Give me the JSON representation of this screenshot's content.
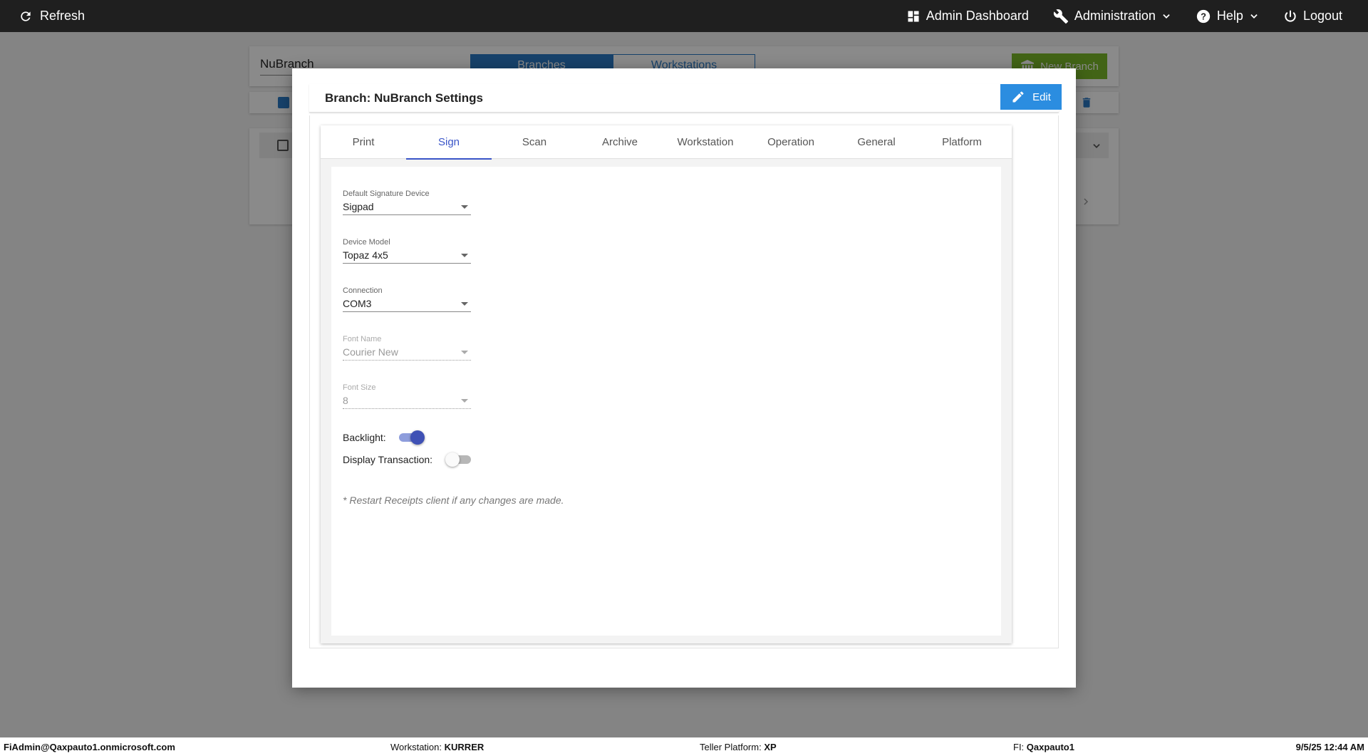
{
  "topbar": {
    "refresh_label": "Refresh",
    "nav": {
      "admin_dashboard": "Admin Dashboard",
      "administration": "Administration",
      "help": "Help",
      "logout": "Logout"
    }
  },
  "background": {
    "branch_select_value": "NuBranch",
    "tabs": [
      "Branches",
      "Workstations"
    ],
    "new_branch_label": "New Branch"
  },
  "modal": {
    "title": "Branch: NuBranch Settings",
    "edit_label": "Edit",
    "tabs": [
      "Print",
      "Sign",
      "Scan",
      "Archive",
      "Workstation",
      "Operation",
      "General",
      "Platform"
    ],
    "active_tab": "Sign",
    "fields": {
      "default_signature_device": {
        "label": "Default Signature Device",
        "value": "Sigpad"
      },
      "device_model": {
        "label": "Device Model",
        "value": "Topaz 4x5"
      },
      "connection": {
        "label": "Connection",
        "value": "COM3"
      },
      "font_name": {
        "label": "Font Name",
        "value": "Courier New"
      },
      "font_size": {
        "label": "Font Size",
        "value": "8"
      }
    },
    "toggles": {
      "backlight": {
        "label": "Backlight:",
        "on": true
      },
      "display_transaction": {
        "label": "Display Transaction:",
        "on": false
      }
    },
    "note": "* Restart Receipts client if any changes are made."
  },
  "statusbar": {
    "user": "FiAdmin@Qaxpauto1.onmicrosoft.com",
    "workstation_label": "Workstation:",
    "workstation_value": "KURRER",
    "platform_label": "Teller Platform:",
    "platform_value": "XP",
    "fi_label": "FI:",
    "fi_value": "Qaxpauto1",
    "datetime": "9/5/25 12:44 AM"
  },
  "colors": {
    "topbar": "#1f1f1f",
    "accent": "#3f51b5",
    "edit_button": "#2b8de0",
    "new_branch_button": "#7ab929"
  }
}
